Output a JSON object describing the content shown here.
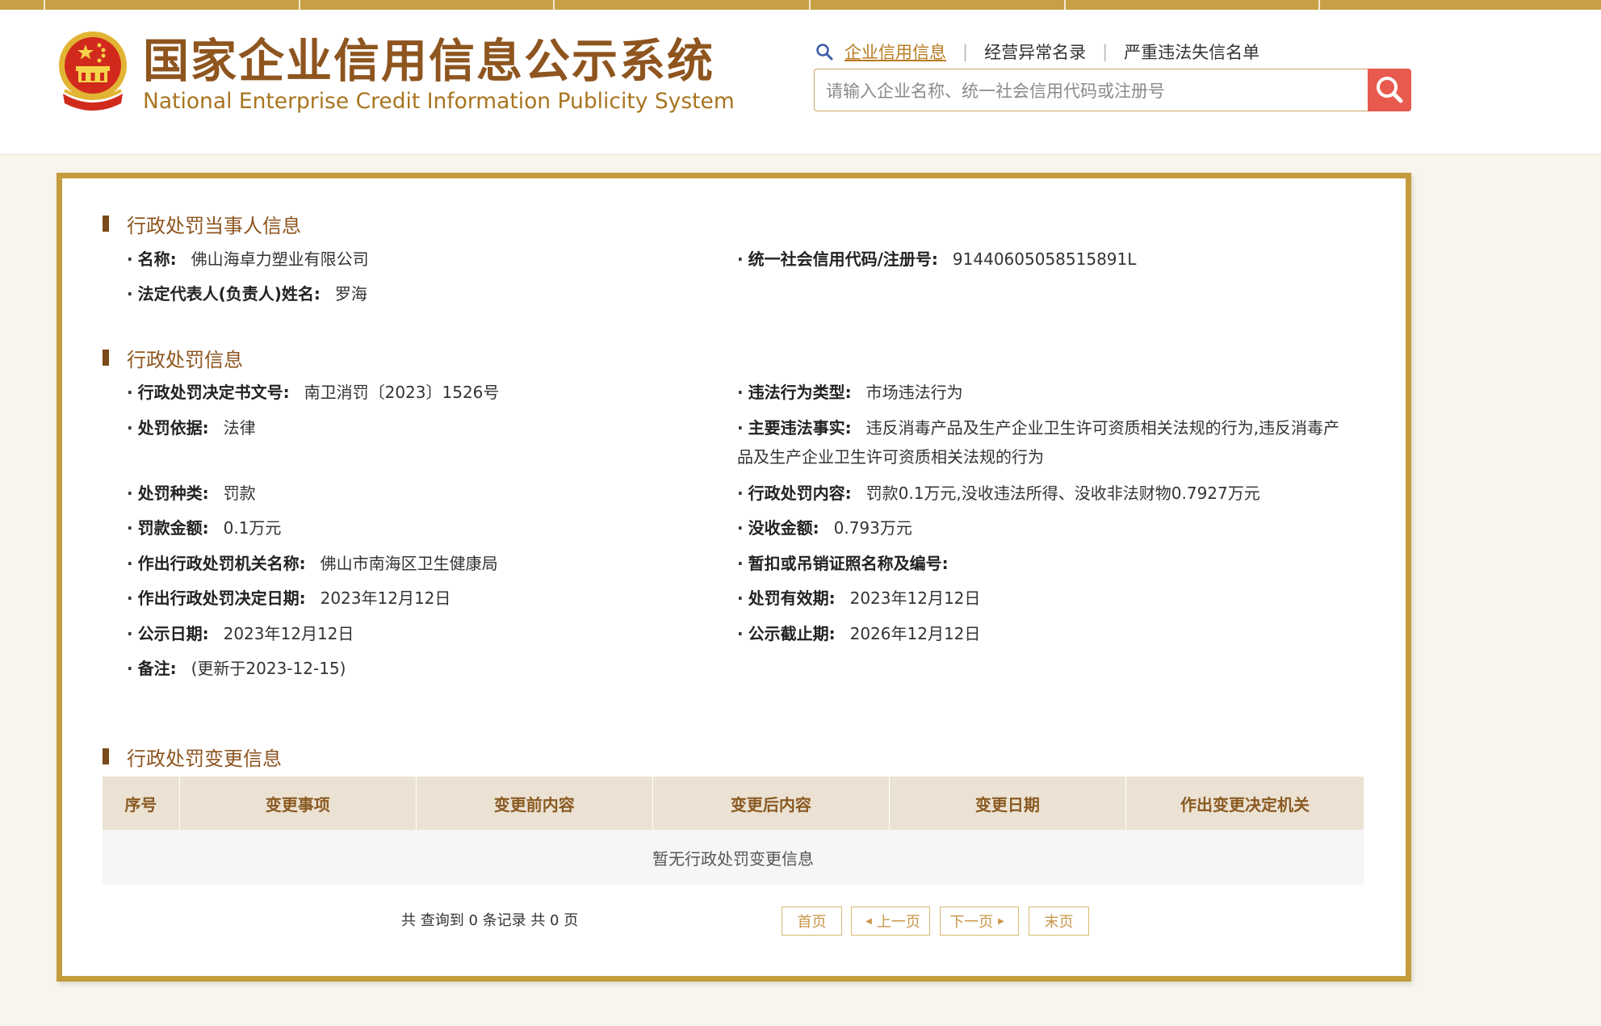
{
  "header": {
    "title_cn": "国家企业信用信息公示系统",
    "title_en": "National Enterprise Credit Information Publicity System",
    "links": [
      "企业信用信息",
      "经营异常名录",
      "严重违法失信名单"
    ],
    "link_separator": "|",
    "search_placeholder": "请输入企业名称、统一社会信用代码或注册号",
    "accent_color": "#c49c3e",
    "search_button_color": "#e85a4e"
  },
  "party": {
    "section_title": "行政处罚当事人信息",
    "name_label": "名称:",
    "name_value": "佛山海卓力塑业有限公司",
    "code_label": "统一社会信用代码/注册号:",
    "code_value": "91440605058515891L",
    "rep_label": "法定代表人(负责人)姓名:",
    "rep_value": "罗海"
  },
  "penalty": {
    "section_title": "行政处罚信息",
    "fields": [
      {
        "label": "行政处罚决定书文号:",
        "value": "南卫消罚〔2023〕1526号"
      },
      {
        "label": "违法行为类型:",
        "value": "市场违法行为"
      },
      {
        "label": "处罚依据:",
        "value": "法律"
      },
      {
        "label": "主要违法事实:",
        "value": "违反消毒产品及生产企业卫生许可资质相关法规的行为,违反消毒产品及生产企业卫生许可资质相关法规的行为"
      },
      {
        "label": "处罚种类:",
        "value": "罚款"
      },
      {
        "label": "行政处罚内容:",
        "value": "罚款0.1万元,没收违法所得、没收非法财物0.7927万元"
      },
      {
        "label": "罚款金额:",
        "value": "0.1万元"
      },
      {
        "label": "没收金额:",
        "value": "0.793万元"
      },
      {
        "label": "作出行政处罚机关名称:",
        "value": "佛山市南海区卫生健康局"
      },
      {
        "label": "暂扣或吊销证照名称及编号:",
        "value": ""
      },
      {
        "label": "作出行政处罚决定日期:",
        "value": "2023年12月12日"
      },
      {
        "label": "处罚有效期:",
        "value": "2023年12月12日"
      },
      {
        "label": "公示日期:",
        "value": "2023年12月12日"
      },
      {
        "label": "公示截止期:",
        "value": "2026年12月12日"
      },
      {
        "label": "备注:",
        "value": "(更新于2023-12-15)"
      }
    ]
  },
  "changes": {
    "section_title": "行政处罚变更信息",
    "columns": [
      "序号",
      "变更事项",
      "变更前内容",
      "变更后内容",
      "变更日期",
      "作出变更决定机关"
    ],
    "empty_text": "暂无行政处罚变更信息",
    "page_info": "共 查询到 0 条记录 共 0 页",
    "pager": {
      "first": "首页",
      "prev": "上一页",
      "next": "下一页",
      "last": "末页"
    }
  }
}
